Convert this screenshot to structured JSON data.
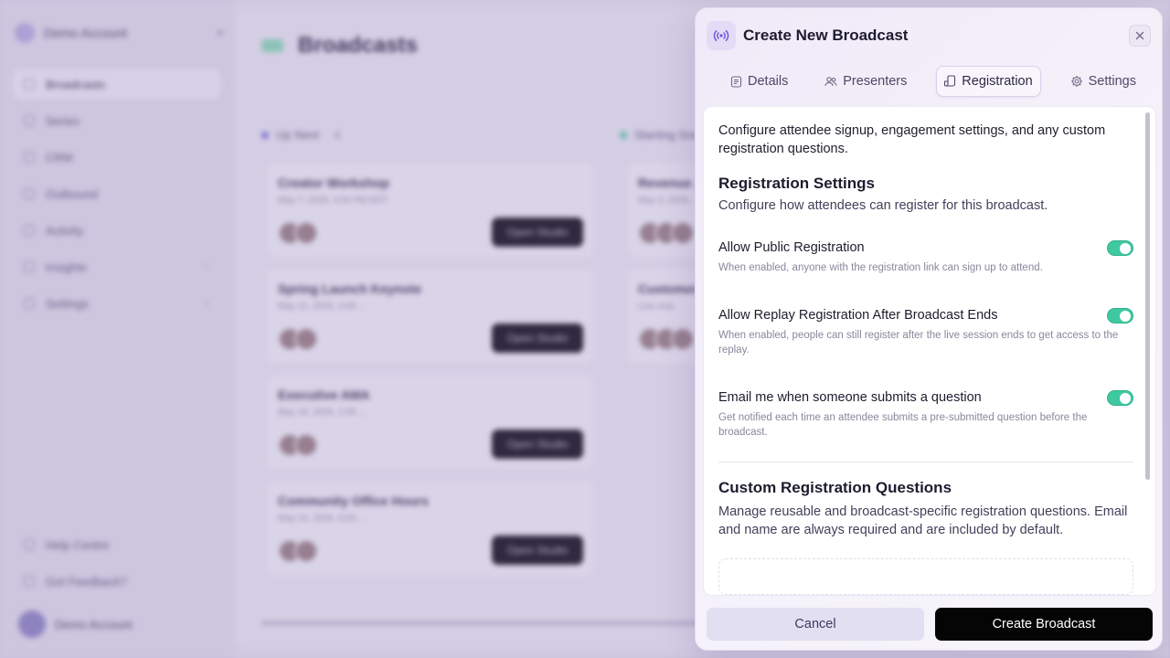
{
  "background": {
    "account_name": "Demo Account",
    "nav_items": [
      "Broadcasts",
      "Series",
      "CRM",
      "Outbound",
      "Activity",
      "Insights",
      "Settings"
    ],
    "bottom_items": [
      "Help Centre",
      "Got Feedback?"
    ],
    "user_name": "Demo Account",
    "page_title": "Broadcasts",
    "columns": [
      {
        "title": "Up Next",
        "count": "4"
      },
      {
        "title": "Starting Soon"
      }
    ],
    "cards": [
      {
        "title": "Creator Workshop",
        "meta": "May 7, 2026, 4:00 PM EDT",
        "button": "Open Studio"
      },
      {
        "title": "Spring Launch Keynote",
        "meta": "May 12, 2026, 3:00 ...",
        "button": "Open Studio"
      },
      {
        "title": "Executive AMA",
        "meta": "May 18, 2026, 2:00 ...",
        "button": "Open Studio"
      },
      {
        "title": "Community Office Hours",
        "meta": "May 24, 2026, 5:00 ...",
        "button": "Open Studio"
      }
    ],
    "cards_right": [
      {
        "title": "Revenue ...",
        "meta": "May 3, 2026..."
      },
      {
        "title": "Customer ...",
        "meta": "Live now"
      }
    ]
  },
  "modal": {
    "title": "Create New Broadcast",
    "tabs": [
      {
        "label": "Details",
        "icon": "details-icon"
      },
      {
        "label": "Presenters",
        "icon": "presenters-icon"
      },
      {
        "label": "Registration",
        "icon": "registration-icon",
        "active": true
      },
      {
        "label": "Settings",
        "icon": "settings-icon"
      }
    ],
    "intro": "Configure attendee signup, engagement settings, and any custom registration questions.",
    "registration_settings": {
      "title": "Registration Settings",
      "description": "Configure how attendees can register for this broadcast.",
      "items": [
        {
          "label": "Allow Public Registration",
          "help": "When enabled, anyone with the registration link can sign up to attend.",
          "enabled": true
        },
        {
          "label": "Allow Replay Registration After Broadcast Ends",
          "help": "When enabled, people can still register after the live session ends to get access to the replay.",
          "enabled": true
        },
        {
          "label": "Email me when someone submits a question",
          "help": "Get notified each time an attendee submits a pre-submitted question before the broadcast.",
          "enabled": true
        }
      ]
    },
    "custom_questions": {
      "title": "Custom Registration Questions",
      "description": "Manage reusable and broadcast-specific registration questions. Email and name are always required and are included by default."
    },
    "footer": {
      "cancel": "Cancel",
      "create": "Create Broadcast"
    }
  },
  "colors": {
    "toggle_on": "#3ec9a0",
    "primary_button": "#050505",
    "secondary_button": "#e1dff1",
    "accent": "#6b5bd2"
  }
}
